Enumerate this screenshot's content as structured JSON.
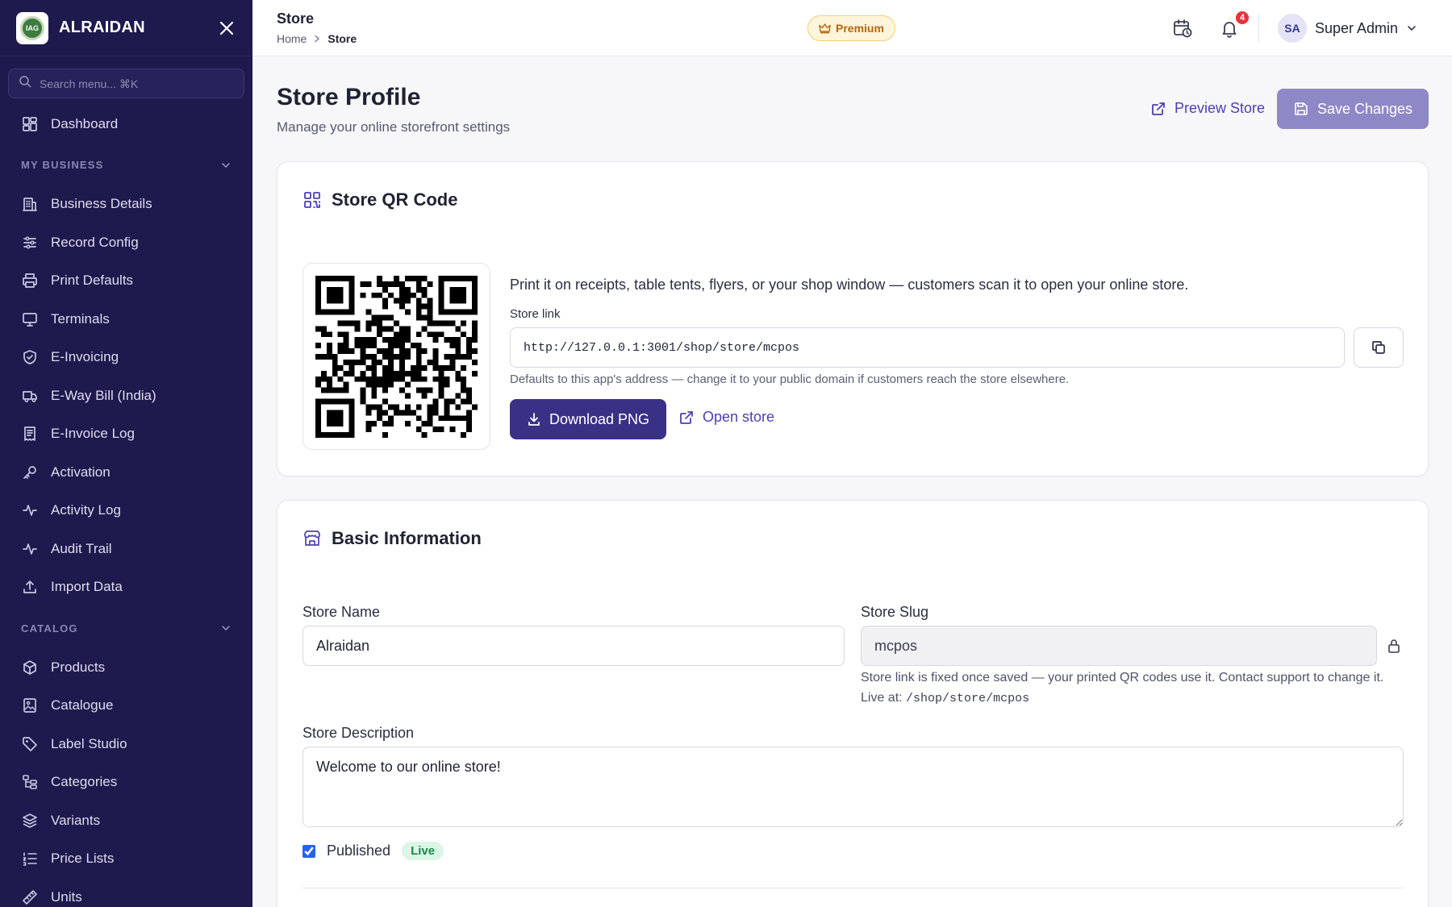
{
  "sidebar": {
    "brand": "ALRAIDAN",
    "logo_text": "IAG",
    "search_placeholder": "Search menu... ⌘K",
    "dashboard": "Dashboard",
    "sections": [
      {
        "title": "MY BUSINESS",
        "items": [
          "Business Details",
          "Record Config",
          "Print Defaults",
          "Terminals",
          "E-Invoicing",
          "E-Way Bill (India)",
          "E-Invoice Log",
          "Activation",
          "Activity Log",
          "Audit Trail",
          "Import Data"
        ]
      },
      {
        "title": "CATALOG",
        "items": [
          "Products",
          "Catalogue",
          "Label Studio",
          "Categories",
          "Variants",
          "Price Lists",
          "Units"
        ]
      }
    ]
  },
  "topbar": {
    "title": "Store",
    "breadcrumb": [
      "Home",
      "Store"
    ],
    "premium": "Premium",
    "notification_count": "4",
    "user_initials": "SA",
    "user_name": "Super Admin"
  },
  "page": {
    "title": "Store Profile",
    "subtitle": "Manage your online storefront settings",
    "preview_label": "Preview Store",
    "save_label": "Save Changes"
  },
  "qr_card": {
    "title": "Store QR Code",
    "description": "Print it on receipts, table tents, flyers, or your shop window — customers scan it to open your online store.",
    "link_label": "Store link",
    "link_value": "http://127.0.0.1:3001/shop/store/mcpos",
    "hint": "Defaults to this app's address — change it to your public domain if customers reach the store elsewhere.",
    "download_label": "Download PNG",
    "open_label": "Open store"
  },
  "basic_card": {
    "title": "Basic Information",
    "store_name_label": "Store Name",
    "store_name_value": "Alraidan",
    "store_slug_label": "Store Slug",
    "store_slug_value": "mcpos",
    "slug_note": "Store link is fixed once saved — your printed QR codes use it. Contact support to change it.",
    "live_at_label": "Live at:",
    "live_at_path": "/shop/store/mcpos",
    "description_label": "Store Description",
    "description_value": "Welcome to our online store!",
    "published_label": "Published",
    "published_checked": true,
    "live_badge": "Live"
  },
  "colors": {
    "sidebar_bg": "#1e1a4d",
    "accent": "#3a3187",
    "link": "#4b40b4",
    "premium": "#b5650f",
    "badge": "#e5343d",
    "live": "#178a48"
  }
}
